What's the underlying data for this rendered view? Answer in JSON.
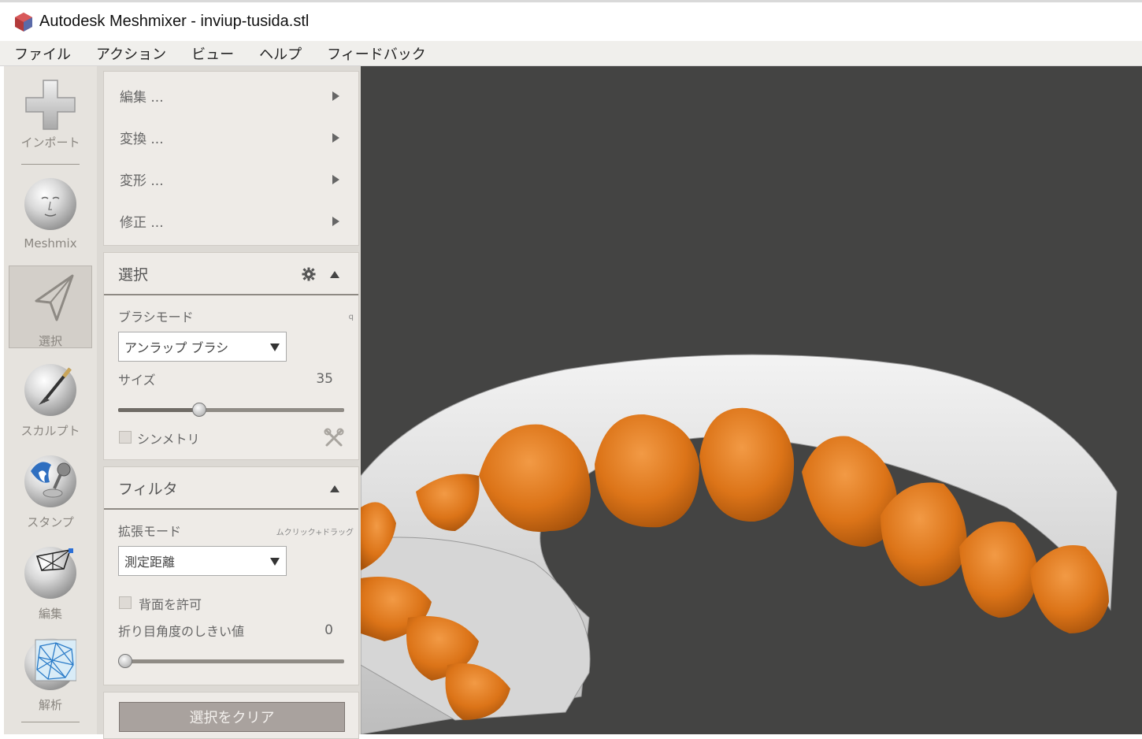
{
  "window": {
    "title": "Autodesk Meshmixer - inviup-tusida.stl"
  },
  "menubar": {
    "items": [
      "ファイル",
      "アクション",
      "ビュー",
      "ヘルプ",
      "フィードバック"
    ]
  },
  "toolbar": {
    "tools": [
      {
        "label": "インポート",
        "icon": "plus-icon"
      },
      {
        "label": "Meshmix",
        "icon": "head-sphere-icon"
      },
      {
        "label": "選択",
        "icon": "arrow-cursor-icon",
        "selected": true
      },
      {
        "label": "スカルプト",
        "icon": "brush-sphere-icon"
      },
      {
        "label": "スタンプ",
        "icon": "stamp-sphere-icon"
      },
      {
        "label": "編集",
        "icon": "mesh-edit-icon"
      },
      {
        "label": "解析",
        "icon": "analysis-icon"
      }
    ]
  },
  "submenu": {
    "items": [
      "編集 ...",
      "変換 ...",
      "変形 ...",
      "修正 ..."
    ]
  },
  "select_panel": {
    "title": "選択",
    "brush_mode_label": "ブラシモード",
    "brush_mode_hint": "q",
    "brush_mode_value": "アンラップ ブラシ",
    "size_label": "サイズ",
    "size_value": "35",
    "size_fraction": 0.36,
    "symmetry_label": "シンメトリ",
    "symmetry_checked": false
  },
  "filter_panel": {
    "title": "フィルタ",
    "expand_mode_label": "拡張モード",
    "expand_mode_hint": "ムクリック+ドラッグ",
    "expand_mode_value": "測定距離",
    "backface_label": "背面を許可",
    "backface_checked": false,
    "crease_label": "折り目角度のしきい値",
    "crease_value": "0",
    "crease_fraction": 0.0
  },
  "action": {
    "clear_selection_label": "選択をクリア"
  },
  "colors": {
    "viewport_bg": "#444443",
    "selection_orange": "#e07a1f",
    "mesh_gray": "#d8d8d8",
    "panel_bg": "#eeebe7"
  }
}
